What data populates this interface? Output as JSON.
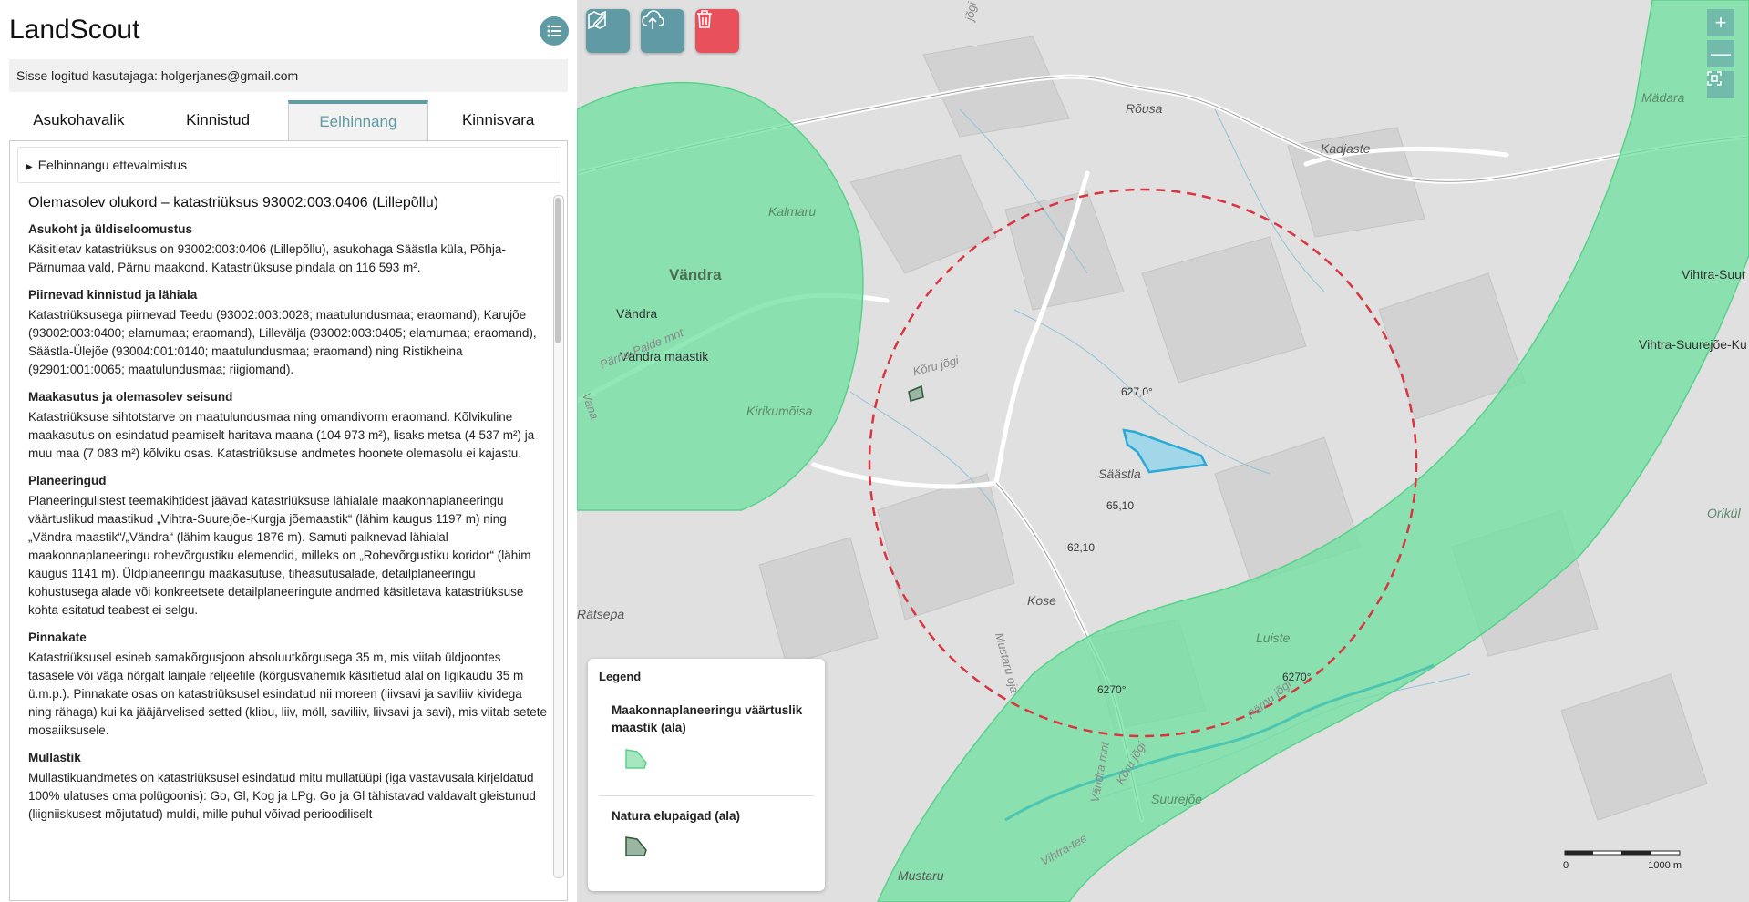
{
  "app": {
    "title": "LandScout",
    "menu_icon": "list-icon"
  },
  "login": {
    "text": "Sisse logitud kasutajaga: holgerjanes@gmail.com"
  },
  "tabs": [
    {
      "label": "Asukohavalik",
      "active": false
    },
    {
      "label": "Kinnistud",
      "active": false
    },
    {
      "label": "Eelhinnang",
      "active": true
    },
    {
      "label": "Kinnisvara",
      "active": false
    }
  ],
  "details": {
    "summary": "Eelhinnangu ettevalmistus"
  },
  "report": {
    "title": "Olemasolev olukord – katastriüksus 93002:003:0406 (Lillepõllu)",
    "sections": [
      {
        "heading": "Asukoht ja üldiseloomustus",
        "text": "Käsitletav katastriüksus on 93002:003:0406 (Lillepõllu), asukohaga Säästla küla, Põhja-Pärnumaa vald, Pärnu maakond. Katastriüksuse pindala on 116 593 m²."
      },
      {
        "heading": "Piirnevad kinnistud ja lähiala",
        "text": "Katastriüksusega piirnevad Teedu (93002:003:0028; maatulundusmaa; eraomand), Karujõe (93002:003:0400; elamumaa; eraomand), Lillevälja (93002:003:0405; elamumaa; eraomand), Säästla-Ülejõe (93004:001:0140; maatulundusmaa; eraomand) ning Ristikheina (92901:001:0065; maatulundusmaa; riigiomand)."
      },
      {
        "heading": "Maakasutus ja olemasolev seisund",
        "text": "Katastriüksuse sihtotstarve on maatulundusmaa ning omandivorm eraomand. Kõlvikuline maakasutus on esindatud peamiselt haritava maana (104 973 m²), lisaks metsa (4 537 m²) ja muu maa (7 083 m²) kõlviku osas. Katastriüksuse andmetes hoonete olemasolu ei kajastu."
      },
      {
        "heading": "Planeeringud",
        "text": "Planeeringulistest teemakihtidest jäävad katastriüksuse lähialale maakonnaplaneeringu väärtuslikud maastikud „Vihtra-Suurejõe-Kurgja jõemaastik“ (lähim kaugus 1197 m) ning „Vändra maastik“/„Vändra“ (lähim kaugus 1876 m). Samuti paiknevad lähialal maakonnaplaneeringu rohevõrgustiku elemendid, milleks on „Rohevõrgustiku koridor“ (lähim kaugus 1141 m). Üldplaneeringu maakasutuse, tiheasutusalade, detailplaneeringu kohustusega alade või konkreetsete detailplaneeringute andmed käsitletava katastriüksuse kohta esitatud teabest ei selgu."
      },
      {
        "heading": "Pinnakate",
        "text": "Katastriüksusel esineb samakõrgusjoon absoluutkõrgusega 35 m, mis viitab üldjoontes tasasele või väga nõrgalt lainjale reljeefile (kõrgusvahemik käsitletud alal on ligikaudu 35 m ü.m.p.). Pinnakate osas on katastriüksusel esindatud nii moreen (liivsavi ja saviliiv kividega ning rähaga) kui ka jääjärvelised setted (klibu, liiv, möll, saviliiv, liivsavi ja savi), mis viitab setete mosaiiksusele."
      },
      {
        "heading": "Mullastik",
        "text": "Mullastikuandmetes on katastriüksusel esindatud mitu mullatüüpi (iga vastavusala kirjeldatud 100% ulatuses oma polügoonis): Go, Gl, Kog ja LPg. Go ja Gl tähistavad valdavalt gleistunud (liigniiskusest mõjutatud) muldi, mille puhul võivad perioodiliselt"
      }
    ]
  },
  "map": {
    "toolbar": [
      {
        "name": "draw-polygon-button",
        "icon": "map-pencil-icon",
        "color": "#5f9aa5"
      },
      {
        "name": "upload-button",
        "icon": "cloud-upload-icon",
        "color": "#5f9aa5"
      },
      {
        "name": "delete-button",
        "icon": "trash-icon",
        "color": "#e8505b"
      }
    ],
    "zoom": {
      "in": "+",
      "out": "—",
      "fit_icon": "fullscreen-icon"
    },
    "places": [
      {
        "text": "Rõusa",
        "cls": "italic"
      },
      {
        "text": "Kadjaste",
        "cls": "italic"
      },
      {
        "text": "Kalmaru",
        "cls": "green"
      },
      {
        "text": "Vändra",
        "cls": "big"
      },
      {
        "text": "Vändra",
        "cls": ""
      },
      {
        "text": "Vändra maastik",
        "cls": ""
      },
      {
        "text": "Kirikumõisa",
        "cls": "green"
      },
      {
        "text": "Säästla",
        "cls": "italic"
      },
      {
        "text": "Kose",
        "cls": "italic"
      },
      {
        "text": "Rätsepa",
        "cls": "italic"
      },
      {
        "text": "Luiste",
        "cls": "green"
      },
      {
        "text": "Suurejõe",
        "cls": "green"
      },
      {
        "text": "Mustaru",
        "cls": "italic"
      },
      {
        "text": "Mädara",
        "cls": "green"
      },
      {
        "text": "Vihtra-Suur",
        "cls": ""
      },
      {
        "text": "Vihtra-Suurejõe-Ku",
        "cls": ""
      },
      {
        "text": "Orikül",
        "cls": "green"
      },
      {
        "text": "Kõru jõgi",
        "cls": "river"
      },
      {
        "text": "627,0°",
        "cls": ""
      },
      {
        "text": "65,10",
        "cls": ""
      },
      {
        "text": "62,10",
        "cls": ""
      },
      {
        "text": "6270°",
        "cls": ""
      },
      {
        "text": "6270°",
        "cls": ""
      },
      {
        "text": "Pärnu jõgi",
        "cls": "river"
      },
      {
        "text": "Mustaru oja",
        "cls": "river"
      },
      {
        "text": "Pärnu-Paide mnt",
        "cls": "river"
      },
      {
        "text": "Vändra mnt",
        "cls": "river"
      },
      {
        "text": "Vihtra-tee",
        "cls": "river"
      },
      {
        "text": "Kõru jõgi",
        "cls": "river"
      },
      {
        "text": "Vana",
        "cls": "river"
      },
      {
        "text": "jõgi",
        "cls": "river"
      }
    ],
    "legend": {
      "title": "Legend",
      "items": [
        {
          "label": "Maakonnaplaneeringu väärtuslik maastik (ala)",
          "fill": "#a8e6bf",
          "stroke": "#5ad18a"
        },
        {
          "label": "Natura elupaigad (ala)",
          "fill": "#9bb5a3",
          "stroke": "#2e5a3a"
        }
      ]
    },
    "scale": {
      "start": "0",
      "end": "1000 m"
    },
    "colors": {
      "green_area": "#6fe0a0",
      "parcel": "#7fd3ee",
      "circle": "#d9343f"
    }
  }
}
